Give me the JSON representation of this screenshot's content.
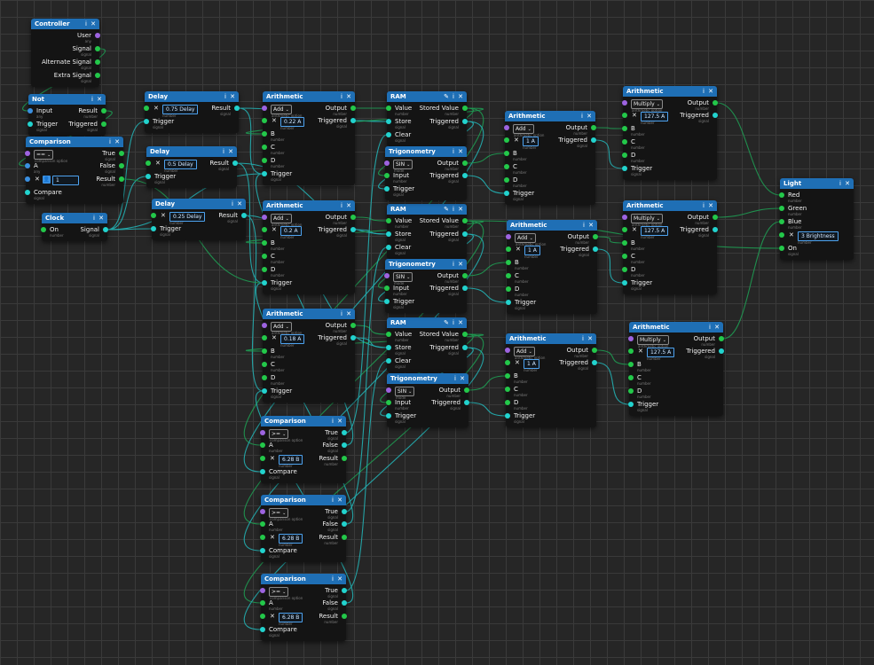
{
  "colors": {
    "header": "#1f6fb5",
    "port_green": "#23c84a",
    "port_cyan": "#22d3ce",
    "port_purple": "#9d63e0",
    "port_blue": "#3a8fe0",
    "wire_green": "#1f9a52",
    "wire_cyan": "#23b0b3"
  },
  "header_icons": {
    "info": "ⅰ",
    "close": "✕",
    "edit": "✎"
  },
  "glyphs": {
    "x": "✕",
    "chevron": "⌄",
    "user": "👤"
  },
  "subs": {
    "signal": "signal",
    "number": "number",
    "any": "any",
    "arith_option": "arithmetic option",
    "comp_option": "comparison option",
    "mode": "mode"
  },
  "labels": {
    "user": "User",
    "signal": "Signal",
    "alt_signal": "Alternate Signal",
    "extra_signal": "Extra Signal",
    "input": "Input",
    "trigger": "Trigger",
    "result": "Result",
    "triggered": "Triggered",
    "true": "True",
    "false": "False",
    "a": "A",
    "b": "B",
    "c": "C",
    "d": "D",
    "compare": "Compare",
    "on": "On",
    "output": "Output",
    "value": "Value",
    "store": "Store",
    "clear": "Clear",
    "stored_value": "Stored Value",
    "red": "Red",
    "green": "Green",
    "blue": "Blue"
  },
  "nodes": {
    "controller": {
      "title": "Controller"
    },
    "not": {
      "title": "Not"
    },
    "comparison_left": {
      "title": "Comparison",
      "op": "==",
      "b_value": "1"
    },
    "clock": {
      "title": "Clock"
    },
    "delay1": {
      "title": "Delay",
      "value": "0.75 Delay"
    },
    "delay2": {
      "title": "Delay",
      "value": "0.5 Delay"
    },
    "delay3": {
      "title": "Delay",
      "value": "0.25 Delay"
    },
    "arith1": {
      "title": "Arithmetic",
      "op": "Add",
      "a_value": "0.22 A"
    },
    "arith2": {
      "title": "Arithmetic",
      "op": "Add",
      "a_value": "0.2 A"
    },
    "arith3": {
      "title": "Arithmetic",
      "op": "Add",
      "a_value": "0.18 A"
    },
    "comp1": {
      "title": "Comparison",
      "op": ">=",
      "b_value": "6.28 B"
    },
    "comp2": {
      "title": "Comparison",
      "op": ">=",
      "b_value": "6.28 B"
    },
    "comp3": {
      "title": "Comparison",
      "op": ">=",
      "b_value": "6.28 B"
    },
    "ram1": {
      "title": "RAM"
    },
    "ram2": {
      "title": "RAM"
    },
    "ram3": {
      "title": "RAM"
    },
    "trig1": {
      "title": "Trigonometry",
      "op": "SIN"
    },
    "trig2": {
      "title": "Trigonometry",
      "op": "SIN"
    },
    "trig3": {
      "title": "Trigonometry",
      "op": "SIN"
    },
    "arith4": {
      "title": "Arithmetic",
      "op": "Add",
      "a_value": "1 A"
    },
    "arith5": {
      "title": "Arithmetic",
      "op": "Add",
      "a_value": "1 A"
    },
    "arith6": {
      "title": "Arithmetic",
      "op": "Add",
      "a_value": "1 A"
    },
    "mult1": {
      "title": "Arithmetic",
      "op": "Multiply",
      "a_value": "127.5 A"
    },
    "mult2": {
      "title": "Arithmetic",
      "op": "Multiply",
      "a_value": "127.5 A"
    },
    "mult3": {
      "title": "Arithmetic",
      "op": "Multiply",
      "a_value": "127.5 A"
    },
    "light": {
      "title": "Light",
      "brightness": "3 Brightness"
    }
  }
}
